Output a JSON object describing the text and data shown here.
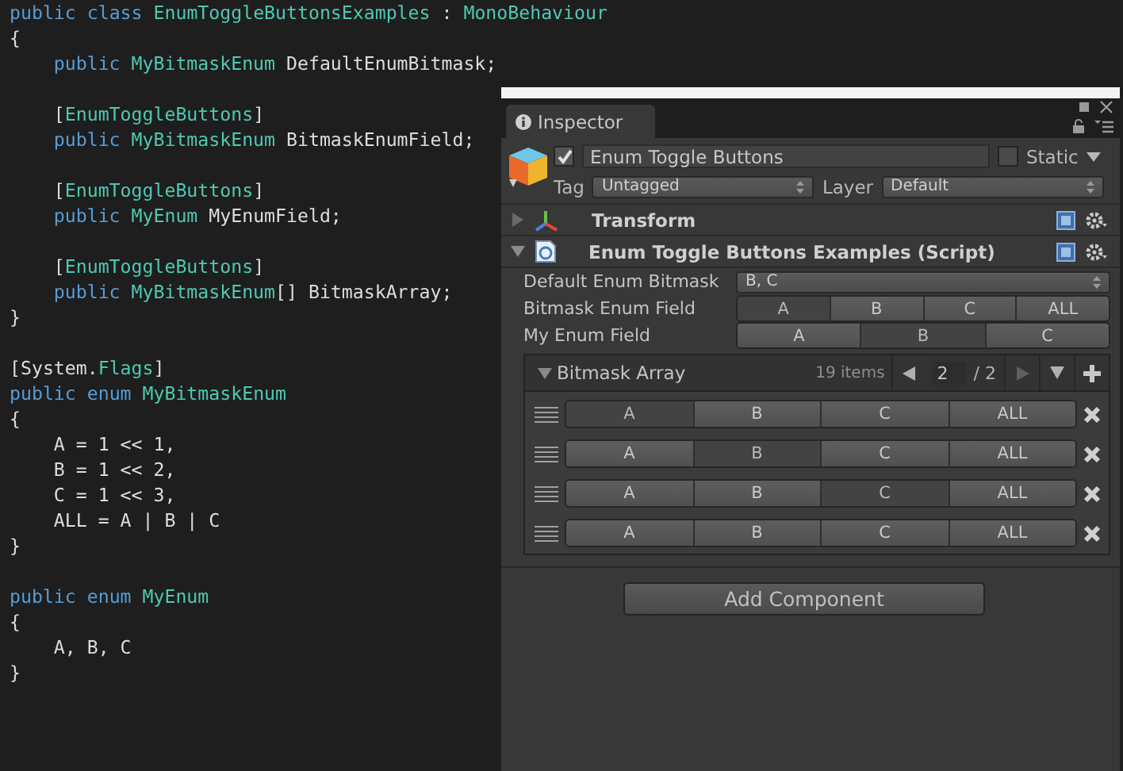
{
  "code": {
    "lines": [
      {
        "kind": "code",
        "indent": false,
        "tokens": [
          {
            "kind": "keyword",
            "text": "public class "
          },
          {
            "kind": "type",
            "text": "EnumToggleButtonsExamples"
          },
          {
            "kind": "plain",
            "text": " : "
          },
          {
            "kind": "type",
            "text": "MonoBehaviour"
          }
        ]
      },
      {
        "kind": "code",
        "indent": false,
        "tokens": [
          {
            "kind": "plain",
            "text": "{"
          }
        ]
      },
      {
        "kind": "code",
        "indent": true,
        "tokens": [
          {
            "kind": "keyword",
            "text": "public "
          },
          {
            "kind": "type",
            "text": "MyBitmaskEnum"
          },
          {
            "kind": "plain",
            "text": " DefaultEnumBitmask;"
          }
        ]
      },
      {
        "kind": "blank"
      },
      {
        "kind": "code",
        "indent": true,
        "tokens": [
          {
            "kind": "plain",
            "text": "["
          },
          {
            "kind": "type",
            "text": "EnumToggleButtons"
          },
          {
            "kind": "plain",
            "text": "]"
          }
        ]
      },
      {
        "kind": "code",
        "indent": true,
        "tokens": [
          {
            "kind": "keyword",
            "text": "public "
          },
          {
            "kind": "type",
            "text": "MyBitmaskEnum"
          },
          {
            "kind": "plain",
            "text": " BitmaskEnumField;"
          }
        ]
      },
      {
        "kind": "blank"
      },
      {
        "kind": "code",
        "indent": true,
        "tokens": [
          {
            "kind": "plain",
            "text": "["
          },
          {
            "kind": "type",
            "text": "EnumToggleButtons"
          },
          {
            "kind": "plain",
            "text": "]"
          }
        ]
      },
      {
        "kind": "code",
        "indent": true,
        "tokens": [
          {
            "kind": "keyword",
            "text": "public "
          },
          {
            "kind": "type",
            "text": "MyEnum"
          },
          {
            "kind": "plain",
            "text": " MyEnumField;"
          }
        ]
      },
      {
        "kind": "blank"
      },
      {
        "kind": "code",
        "indent": true,
        "tokens": [
          {
            "kind": "plain",
            "text": "["
          },
          {
            "kind": "type",
            "text": "EnumToggleButtons"
          },
          {
            "kind": "plain",
            "text": "]"
          }
        ]
      },
      {
        "kind": "code",
        "indent": true,
        "tokens": [
          {
            "kind": "keyword",
            "text": "public "
          },
          {
            "kind": "type",
            "text": "MyBitmaskEnum"
          },
          {
            "kind": "plain",
            "text": "[] BitmaskArray;"
          }
        ]
      },
      {
        "kind": "code",
        "indent": false,
        "tokens": [
          {
            "kind": "plain",
            "text": "}"
          }
        ]
      },
      {
        "kind": "blank"
      },
      {
        "kind": "code",
        "indent": false,
        "tokens": [
          {
            "kind": "plain",
            "text": "[System."
          },
          {
            "kind": "type",
            "text": "Flags"
          },
          {
            "kind": "plain",
            "text": "]"
          }
        ]
      },
      {
        "kind": "code",
        "indent": false,
        "tokens": [
          {
            "kind": "keyword",
            "text": "public enum "
          },
          {
            "kind": "type",
            "text": "MyBitmaskEnum"
          }
        ]
      },
      {
        "kind": "code",
        "indent": false,
        "tokens": [
          {
            "kind": "plain",
            "text": "{"
          }
        ]
      },
      {
        "kind": "code",
        "indent": true,
        "tokens": [
          {
            "kind": "plain",
            "text": "A = 1 << 1,"
          }
        ]
      },
      {
        "kind": "code",
        "indent": true,
        "tokens": [
          {
            "kind": "plain",
            "text": "B = 1 << 2,"
          }
        ]
      },
      {
        "kind": "code",
        "indent": true,
        "tokens": [
          {
            "kind": "plain",
            "text": "C = 1 << 3,"
          }
        ]
      },
      {
        "kind": "code",
        "indent": true,
        "tokens": [
          {
            "kind": "plain",
            "text": "ALL = A | B | C"
          }
        ]
      },
      {
        "kind": "code",
        "indent": false,
        "tokens": [
          {
            "kind": "plain",
            "text": "}"
          }
        ]
      },
      {
        "kind": "blank"
      },
      {
        "kind": "code",
        "indent": false,
        "tokens": [
          {
            "kind": "keyword",
            "text": "public enum "
          },
          {
            "kind": "type",
            "text": "MyEnum"
          }
        ]
      },
      {
        "kind": "code",
        "indent": false,
        "tokens": [
          {
            "kind": "plain",
            "text": "{"
          }
        ]
      },
      {
        "kind": "code",
        "indent": true,
        "tokens": [
          {
            "kind": "plain",
            "text": "A, B, C"
          }
        ]
      },
      {
        "kind": "code",
        "indent": false,
        "tokens": [
          {
            "kind": "plain",
            "text": "}"
          }
        ]
      }
    ]
  },
  "inspector": {
    "tab": "Inspector",
    "object": {
      "active": true,
      "name": "Enum Toggle Buttons",
      "static": false,
      "static_label": "Static",
      "tag_label": "Tag",
      "tag": "Untagged",
      "layer_label": "Layer",
      "layer": "Default"
    },
    "components": [
      {
        "kind": "transform",
        "name": "Transform",
        "expanded": false
      },
      {
        "kind": "script",
        "name": "Enum Toggle Buttons Examples (Script)",
        "expanded": true
      }
    ],
    "fields": [
      {
        "kind": "dropdown",
        "label": "Default Enum Bitmask",
        "value": "B, C"
      },
      {
        "kind": "toggles",
        "label": "Bitmask Enum Field",
        "options": [
          {
            "label": "A",
            "selected": true
          },
          {
            "label": "B",
            "selected": false
          },
          {
            "label": "C",
            "selected": false
          },
          {
            "label": "ALL",
            "selected": false
          }
        ]
      },
      {
        "kind": "toggles",
        "label": "My Enum Field",
        "options": [
          {
            "label": "A",
            "selected": false
          },
          {
            "label": "B",
            "selected": true
          },
          {
            "label": "C",
            "selected": false
          }
        ]
      }
    ],
    "array": {
      "label": "Bitmask Array",
      "expanded": true,
      "count": "19 items",
      "page": "2",
      "pages": "/ 2",
      "elements": [
        {
          "options": [
            {
              "label": "A",
              "selected": true
            },
            {
              "label": "B",
              "selected": false
            },
            {
              "label": "C",
              "selected": false
            },
            {
              "label": "ALL",
              "selected": false
            }
          ]
        },
        {
          "options": [
            {
              "label": "A",
              "selected": false
            },
            {
              "label": "B",
              "selected": true
            },
            {
              "label": "C",
              "selected": false
            },
            {
              "label": "ALL",
              "selected": false
            }
          ]
        },
        {
          "options": [
            {
              "label": "A",
              "selected": false
            },
            {
              "label": "B",
              "selected": false
            },
            {
              "label": "C",
              "selected": true
            },
            {
              "label": "ALL",
              "selected": false
            }
          ]
        },
        {
          "options": [
            {
              "label": "A",
              "selected": false
            },
            {
              "label": "B",
              "selected": false
            },
            {
              "label": "C",
              "selected": false
            },
            {
              "label": "ALL",
              "selected": false
            }
          ]
        }
      ]
    },
    "add_component": "Add Component"
  }
}
